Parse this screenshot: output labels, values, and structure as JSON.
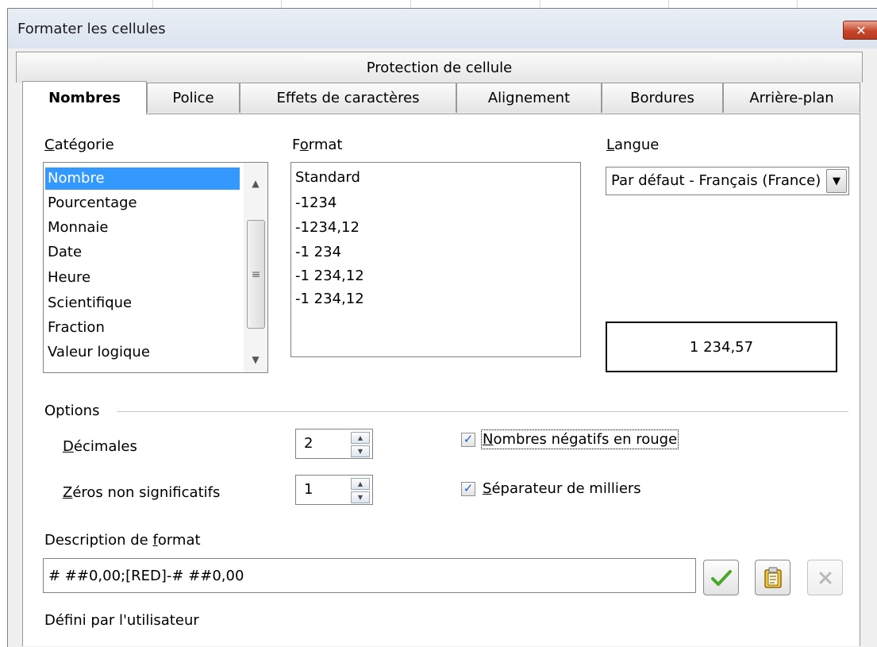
{
  "dialog": {
    "title": "Formater les cellules",
    "close_glyph": "✕"
  },
  "tabs": {
    "row1": [
      "Protection de cellule"
    ],
    "row2": [
      "Nombres",
      "Police",
      "Effets de caractères",
      "Alignement",
      "Bordures",
      "Arrière-plan"
    ],
    "active": "Nombres"
  },
  "category": {
    "label_first": "C",
    "label_rest": "atégorie",
    "items": [
      "Nombre",
      "Pourcentage",
      "Monnaie",
      "Date",
      "Heure",
      "Scientifique",
      "Fraction",
      "Valeur logique"
    ],
    "selected": "Nombre"
  },
  "format": {
    "label_pre": "F",
    "label_u": "o",
    "label_rest": "rmat",
    "items": [
      "Standard",
      "-1234",
      "-1234,12",
      "-1 234",
      "-1 234,12",
      "-1 234,12"
    ]
  },
  "langue": {
    "label_first": "L",
    "label_rest": "angue",
    "value": "Par défaut - Français (France)"
  },
  "preview": {
    "value": "1 234,57"
  },
  "options": {
    "title": "Options",
    "decimales_first": "D",
    "decimales_rest": "écimales",
    "decimales_value": "2",
    "zeros_first": "Z",
    "zeros_rest": "éros non significatifs",
    "zeros_value": "1",
    "negatifs_first": "N",
    "negatifs_rest": "ombres négatifs en rouge",
    "negatifs_checked": true,
    "separateur_first": "S",
    "separateur_rest": "éparateur de milliers",
    "separateur_checked": true
  },
  "description": {
    "label_pre": "Description de ",
    "label_u": "f",
    "label_rest": "ormat",
    "value": "# ##0,00;[RED]-# ##0,00",
    "status": "Défini par l'utilisateur"
  },
  "icons": {
    "accept": "check-icon",
    "edit": "clipboard-icon",
    "delete": "delete-icon"
  },
  "colors": {
    "selection": "#3399ff",
    "close": "#c7462b",
    "accept": "#4aa82a"
  }
}
